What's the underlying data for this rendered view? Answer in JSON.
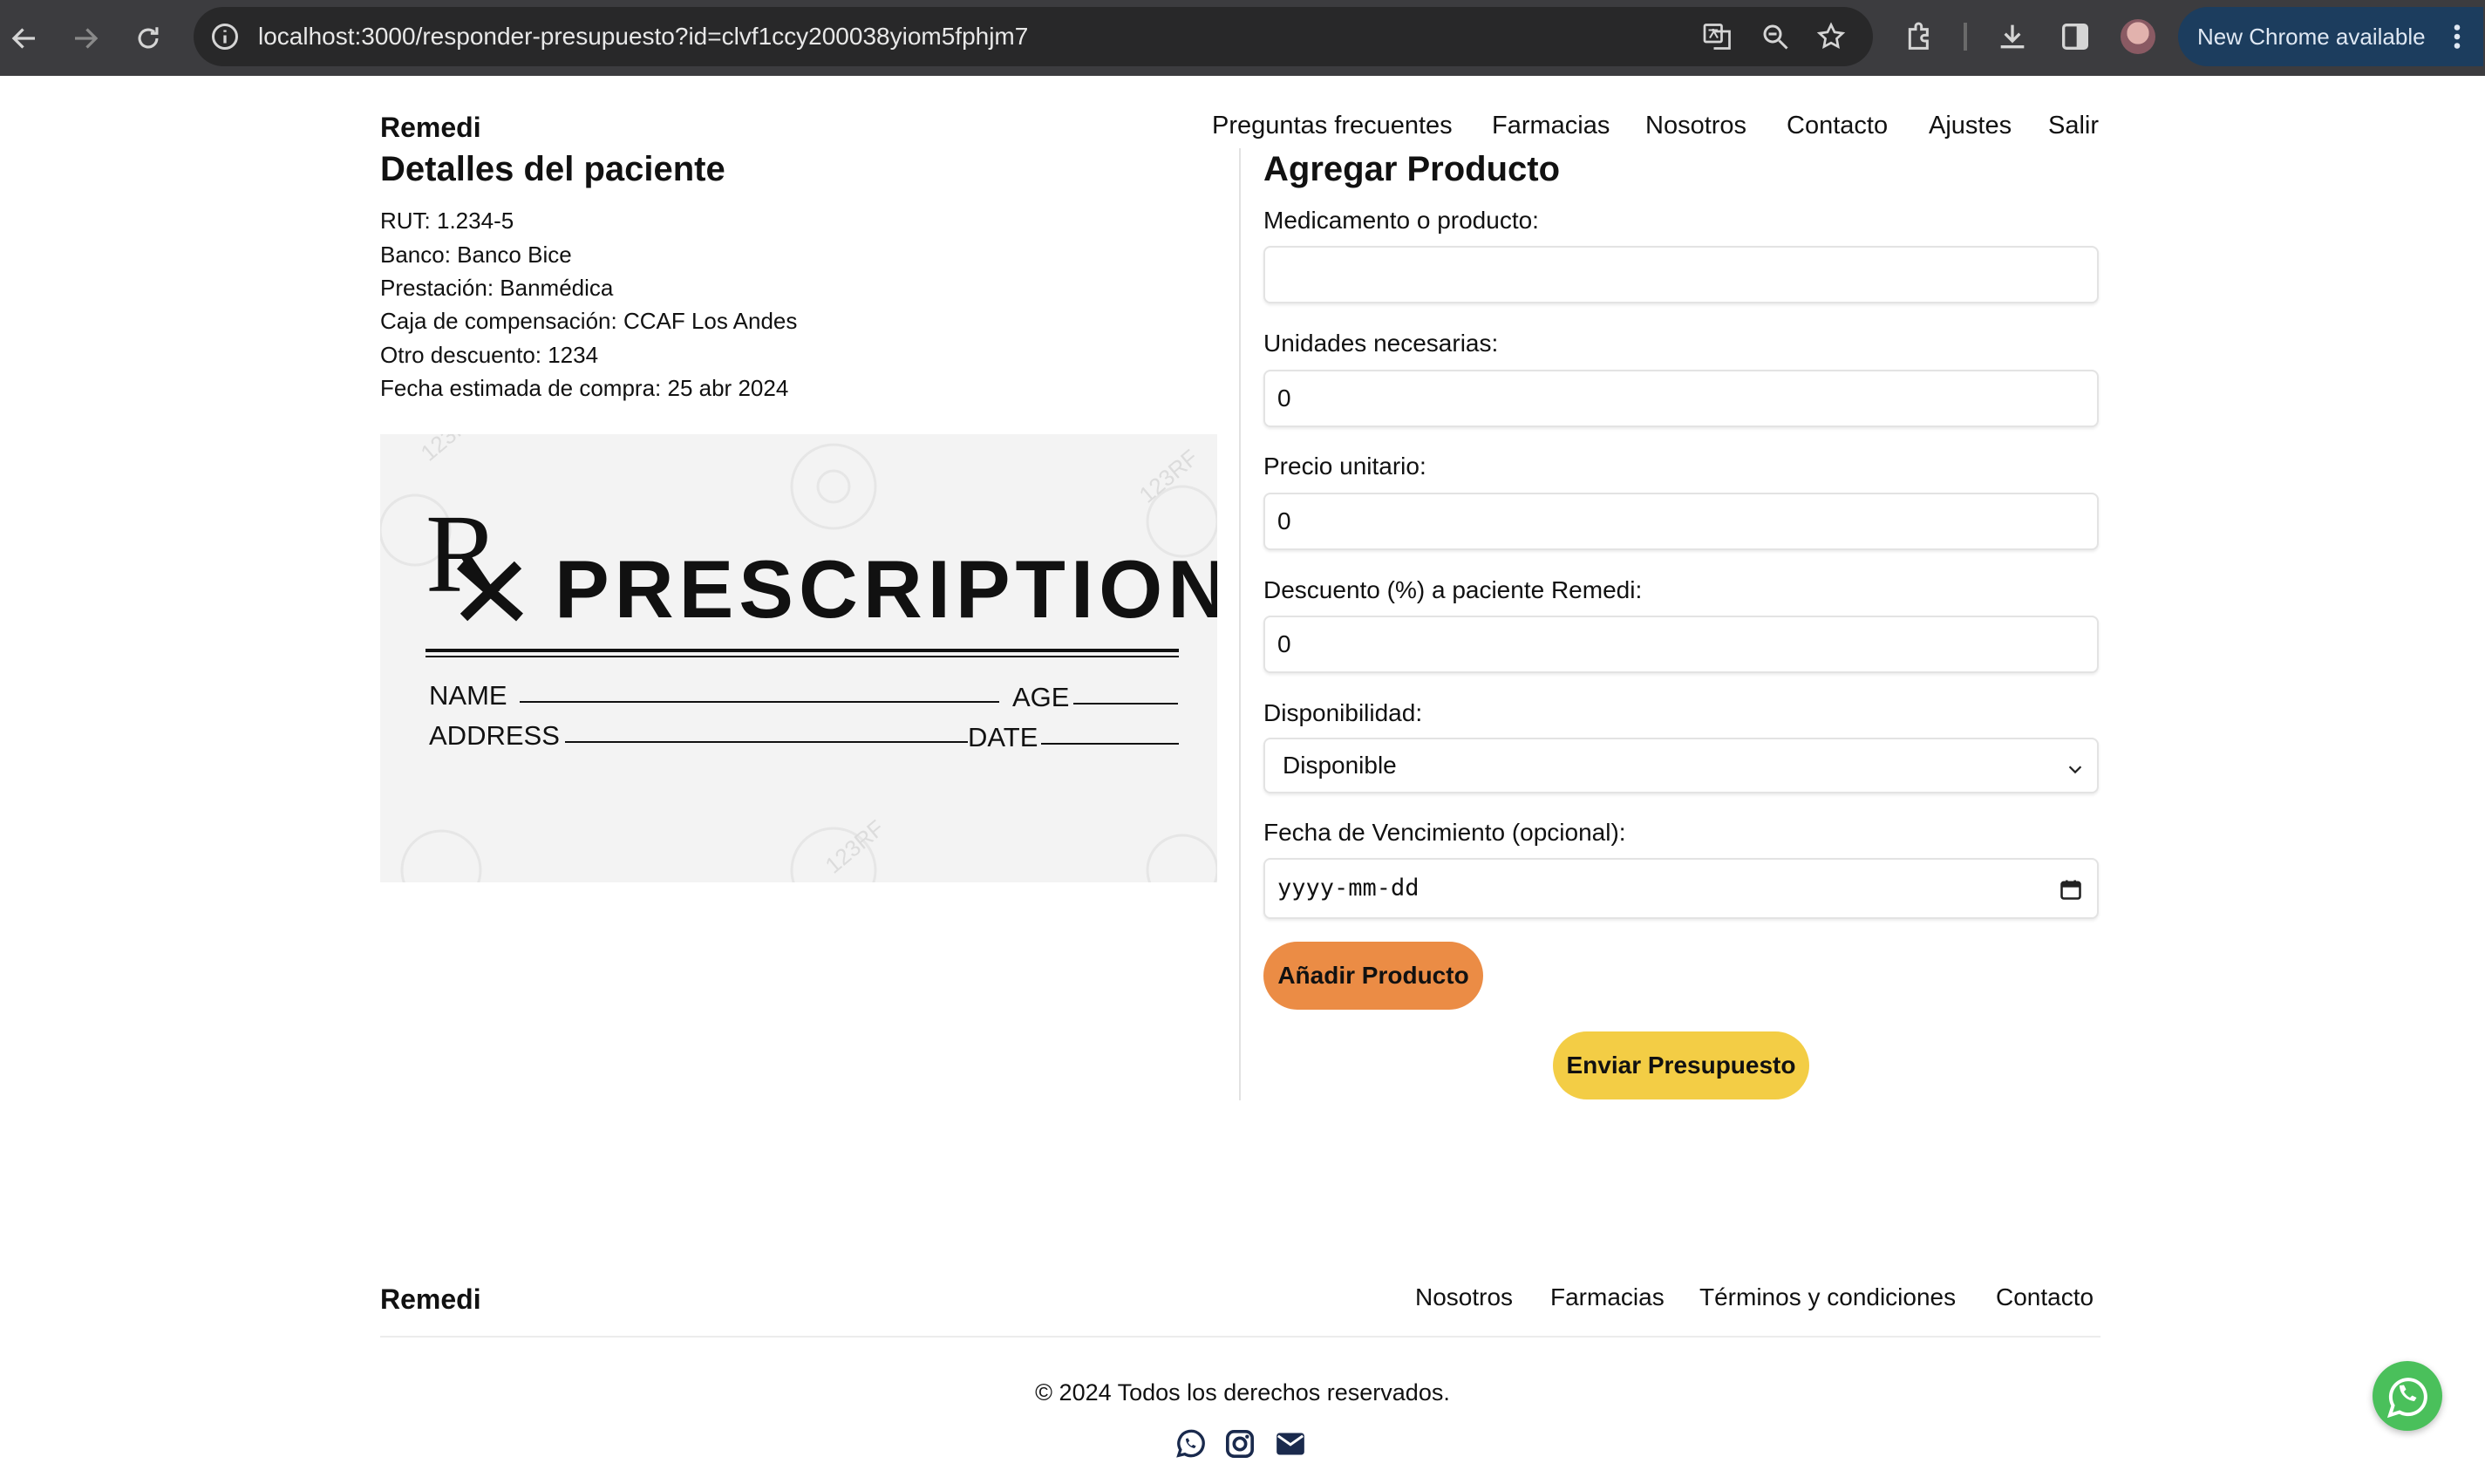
{
  "browser": {
    "url": "localhost:3000/responder-presupuesto?id=clvf1ccy200038yiom5fphjm7",
    "update_label": "New Chrome available",
    "icons": [
      "back-icon",
      "forward-icon",
      "reload-icon",
      "site-info-icon",
      "translate-icon",
      "zoom-icon",
      "bookmark-star-icon",
      "extensions-icon",
      "download-icon",
      "side-panel-icon",
      "profile-avatar",
      "more-icon"
    ]
  },
  "header": {
    "brand": "Remedi",
    "nav": [
      "Preguntas frecuentes",
      "Farmacias",
      "Nosotros",
      "Contacto",
      "Ajustes",
      "Salir"
    ]
  },
  "patient": {
    "title": "Detalles del paciente",
    "lines": [
      "RUT: 1.234-5",
      "Banco: Banco Bice",
      "Prestación: Banmédica",
      "Caja de compensación: CCAF Los Andes",
      "Otro descuento: 1234",
      "Fecha estimada de compra: 25 abr 2024"
    ],
    "prescription_image": {
      "rx": "R",
      "title": "PRESCRIPTION",
      "name_label": "NAME",
      "age_label": "AGE",
      "address_label": "ADDRESS",
      "date_label": "DATE",
      "watermark": "123RF"
    }
  },
  "form": {
    "title": "Agregar Producto",
    "product_label": "Medicamento o producto:",
    "product_value": "",
    "units_label": "Unidades necesarias:",
    "units_value": "0",
    "price_label": "Precio unitario:",
    "price_value": "0",
    "discount_label": "Descuento (%) a paciente Remedi:",
    "discount_value": "0",
    "availability_label": "Disponibilidad:",
    "availability_value": "Disponible",
    "expiry_label": "Fecha de Vencimiento (opcional):",
    "expiry_placeholder": "yyyy-mm-dd",
    "add_button": "Añadir Producto",
    "send_button": "Enviar Presupuesto",
    "colors": {
      "add_button": "#eb8c45",
      "send_button": "#f3cd45"
    }
  },
  "footer": {
    "brand": "Remedi",
    "links": [
      "Nosotros",
      "Farmacias",
      "Términos y condiciones",
      "Contacto"
    ],
    "copyright": "© 2024 Todos los derechos reservados.",
    "social_icons": [
      "whatsapp-icon",
      "instagram-icon",
      "mail-icon"
    ]
  },
  "floating": {
    "icon": "whatsapp-icon",
    "color": "#4ac05b"
  }
}
